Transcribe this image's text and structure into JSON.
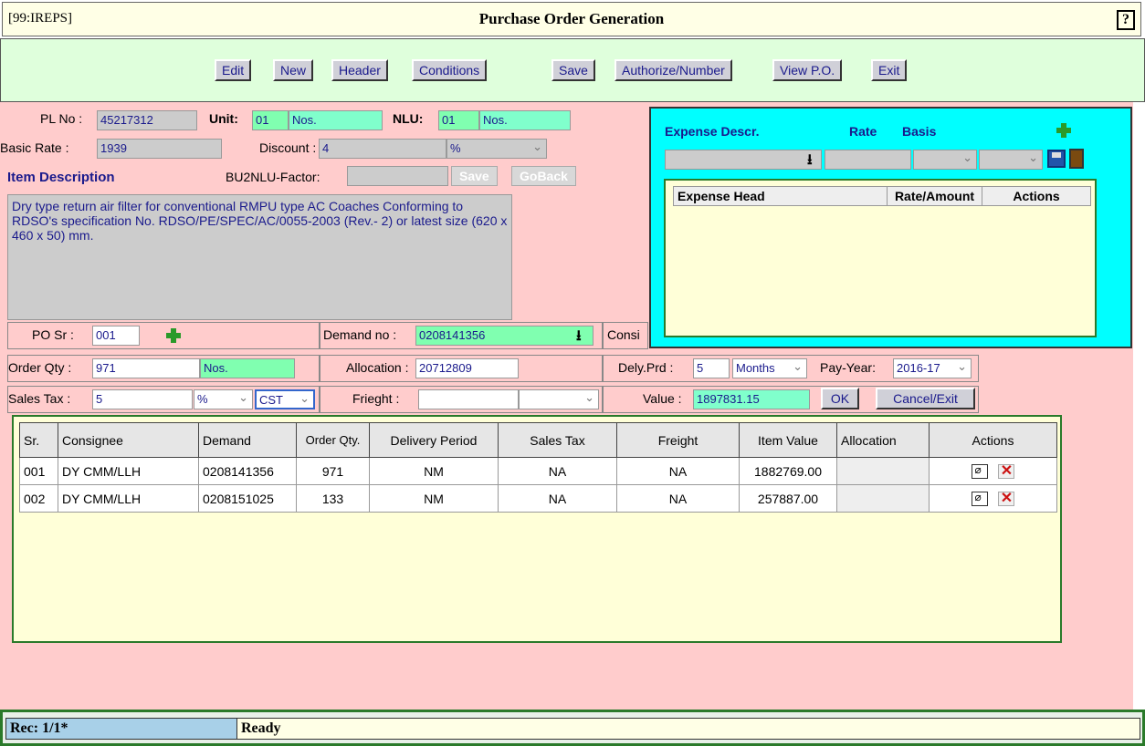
{
  "titlebar": {
    "app_id": "[99:IREPS]",
    "title": "Purchase Order Generation",
    "help": "?"
  },
  "toolbar": {
    "edit": "Edit",
    "new": "New",
    "header": "Header",
    "conditions": "Conditions",
    "save": "Save",
    "authorize": "Authorize/Number",
    "view_po": "View P.O.",
    "exit": "Exit"
  },
  "item": {
    "pl_no_label": "PL No :",
    "pl_no": "45217312",
    "unit_label": "Unit:",
    "unit_code": "01",
    "unit_name": "Nos.",
    "nlu_label": "NLU:",
    "nlu_code": "01",
    "nlu_name": "Nos.",
    "basic_rate_label": "Basic Rate :",
    "basic_rate": "1939",
    "discount_label": "Discount :",
    "discount": "4",
    "discount_type": "%",
    "desc_label": "Item Description",
    "bu2nlu_label": "BU2NLU-Factor:",
    "bu2nlu": "",
    "save": "Save",
    "goback": "GoBack",
    "description": "Dry type return air filter for conventional  RMPU type AC Coaches Conforming to RDSO's specification No. RDSO/PE/SPEC/AC/0055-2003 (Rev.- 2) or latest size (620 x 460 x 50) mm."
  },
  "order": {
    "po_sr_label": "PO Sr :",
    "po_sr": "001",
    "demand_label": "Demand no :",
    "demand": "0208141356",
    "consignee_label": "Consi",
    "order_qty_label": "Order Qty :",
    "order_qty": "971",
    "order_unit": "Nos.",
    "allocation_label": "Allocation :",
    "allocation": "20712809",
    "dely_label": "Dely.Prd :",
    "dely": "5",
    "dely_unit": "Months",
    "payyear_label": "Pay-Year:",
    "payyear": "2016-17",
    "salestax_label": "Sales Tax :",
    "salestax": "5",
    "salestax_type": "%",
    "salestax_kind": "CST",
    "freight_label": "Frieght :",
    "freight": "",
    "freight_type": "",
    "value_label": "Value :",
    "value": "1897831.15",
    "ok": "OK",
    "cancel": "Cancel/Exit"
  },
  "expense": {
    "descr_label": "Expense Descr.",
    "rate_label": "Rate",
    "basis_label": "Basis",
    "cols": [
      "Expense Head",
      "Rate/Amount",
      "Actions"
    ]
  },
  "grid": {
    "headers": [
      "Sr.",
      "Consignee",
      "Demand",
      "Order Qty.",
      "Delivery Period",
      "Sales Tax",
      "Freight",
      "Item Value",
      "Allocation",
      "Actions"
    ],
    "rows": [
      {
        "sr": "001",
        "consignee": "DY CMM/LLH",
        "demand": "0208141356",
        "qty": "971",
        "delivery": "NM",
        "tax": "NA",
        "freight": "NA",
        "value": "1882769.00",
        "allocation": ""
      },
      {
        "sr": "002",
        "consignee": "DY CMM/LLH",
        "demand": "0208151025",
        "qty": "133",
        "delivery": "NM",
        "tax": "NA",
        "freight": "NA",
        "value": "257887.00",
        "allocation": ""
      }
    ]
  },
  "status": {
    "rec": "Rec: 1/1*",
    "message": "Ready"
  },
  "icons": {
    "add": "add-plus-icon",
    "download": "download-arrow-icon",
    "save": "floppy-disk-icon",
    "exit": "door-exit-icon",
    "edit": "edit-pencil-icon",
    "delete": "delete-x-icon"
  }
}
